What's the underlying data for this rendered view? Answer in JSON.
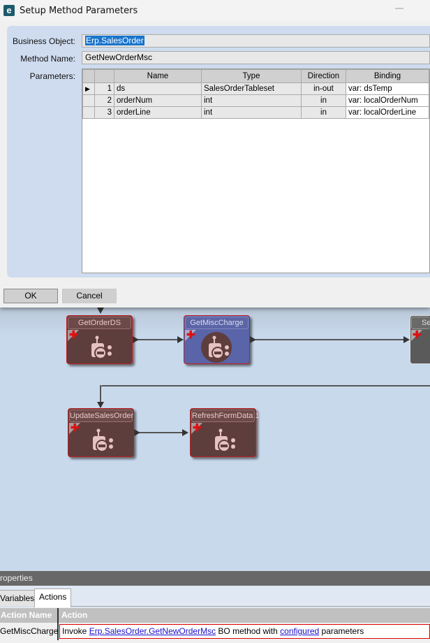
{
  "dialog": {
    "title": "Setup Method Parameters",
    "business_object_label": "Business Object:",
    "business_object": "Erp.SalesOrder",
    "method_name_label": "Method Name:",
    "method_name": "GetNewOrderMsc",
    "parameters_label": "Parameters:",
    "columns": [
      "Name",
      "Type",
      "Direction",
      "Binding"
    ],
    "rows": [
      {
        "num": "1",
        "name": "ds",
        "type": "SalesOrderTableset",
        "direction": "in-out",
        "binding": "var: dsTemp"
      },
      {
        "num": "2",
        "name": "orderNum",
        "type": "int",
        "direction": "in",
        "binding": "var: localOrderNum"
      },
      {
        "num": "3",
        "name": "orderLine",
        "type": "int",
        "direction": "in",
        "binding": "var: localOrderLine"
      }
    ],
    "ok": "OK",
    "cancel": "Cancel"
  },
  "nodes": [
    "GetOrderDS",
    "GetMiscCharge",
    "Se",
    "UpdateSalesOrder",
    "RefreshFormData 1"
  ],
  "properties": {
    "title": "roperties",
    "tabs": [
      "Variables",
      "Actions"
    ],
    "col_name": "Action Name",
    "col_action": "Action",
    "row_name": "GetMiscCharge",
    "action_prefix": "Invoke ",
    "action_link": "Erp.SalesOrder.GetNewOrderMsc",
    "action_mid": " BO method with ",
    "action_link2": "configured",
    "action_suffix": " parameters"
  }
}
